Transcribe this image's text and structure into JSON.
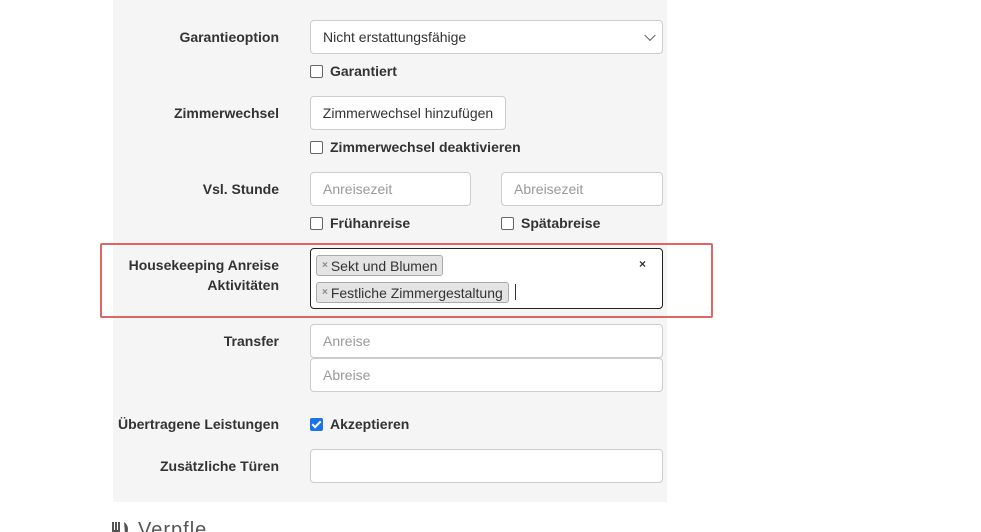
{
  "form": {
    "guarantee": {
      "label": "Garantieoption",
      "select_value": "Nicht erstattungsfähige",
      "checkbox_label": "Garantiert",
      "checkbox_checked": false
    },
    "room_change": {
      "label": "Zimmerwechsel",
      "button_label": "Zimmerwechsel hinzufügen",
      "checkbox_label": "Zimmerwechsel deaktivieren",
      "checkbox_checked": false
    },
    "late_hour": {
      "label": "Vsl. Stunde",
      "arrival_placeholder": "Anreisezeit",
      "departure_placeholder": "Abreisezeit",
      "early_checkbox_label": "Frühanreise",
      "late_checkbox_label": "Spätabreise"
    },
    "housekeeping": {
      "label_line1": "Housekeeping Anreise",
      "label_line2": "Aktivitäten",
      "tags": [
        "Sekt und Blumen",
        "Festliche Zimmergestaltung"
      ],
      "tag_remove_symbol": "×",
      "clear_symbol": "×"
    },
    "transfer": {
      "label": "Transfer",
      "arrival_placeholder": "Anreise",
      "departure_placeholder": "Abreise"
    },
    "transferred_services": {
      "label": "Übertragene Leistungen",
      "checkbox_label": "Akzeptieren",
      "checkbox_checked": true
    },
    "extra_doors": {
      "label": "Zusätzliche Türen",
      "value": ""
    }
  },
  "next_section": {
    "title_partial": "Verpfle",
    "icon": "cutlery-icon"
  },
  "colors": {
    "panel_bg": "#f5f5f5",
    "highlight_border": "#e06666",
    "checkbox_checked": "#1a73e8"
  }
}
